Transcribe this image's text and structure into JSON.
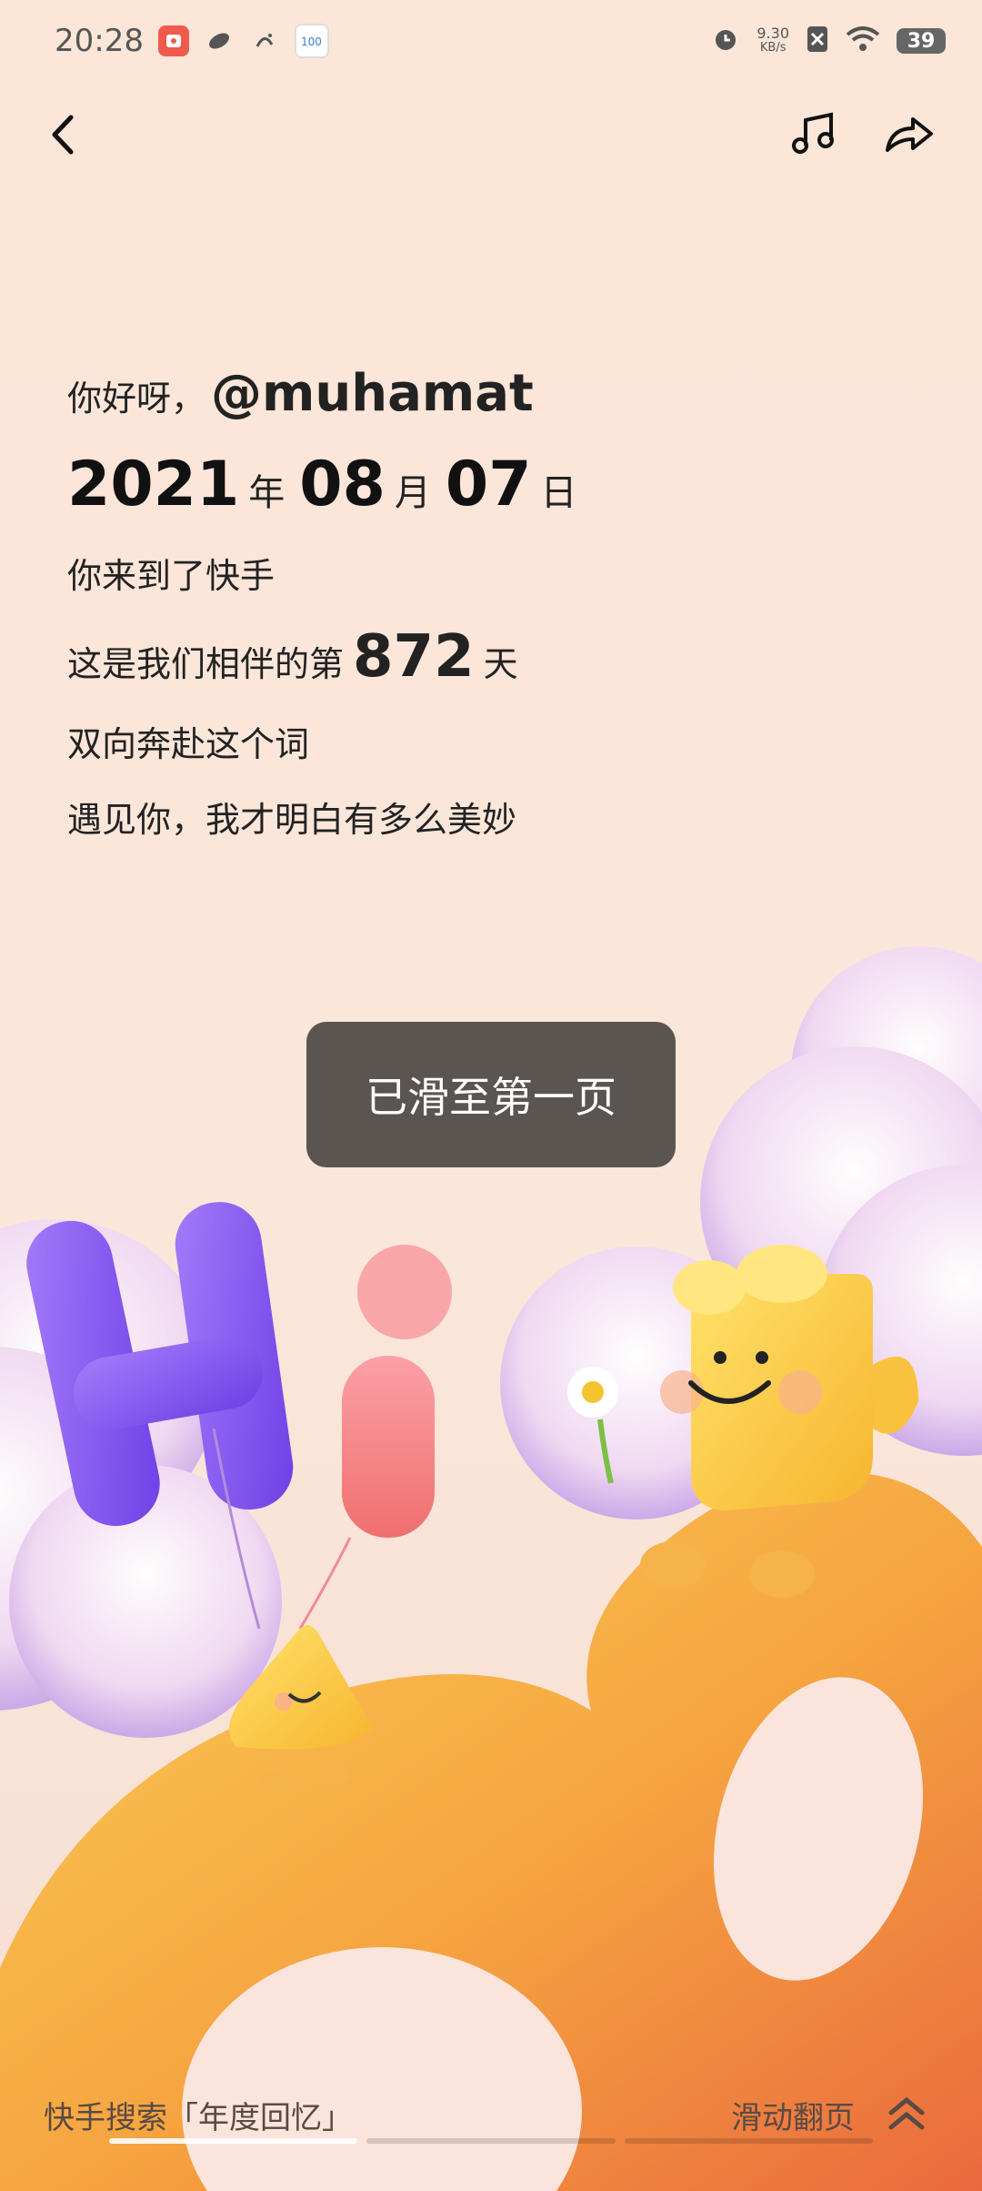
{
  "status_bar": {
    "time": "20:28",
    "net_speed_value": "9.30",
    "net_speed_unit": "KB/s",
    "battery": "39"
  },
  "nav": {
    "back_icon": "chevron-left-icon",
    "music_icon": "music-icon",
    "share_icon": "share-icon"
  },
  "greeting": {
    "hello": "你好呀，",
    "username": "@muhamat",
    "year": "2021",
    "year_unit": "年",
    "month": "08",
    "month_unit": "月",
    "day": "07",
    "day_unit": "日",
    "came_to": "你来到了快手",
    "companion_prefix": "这是我们相伴的第",
    "days": "872",
    "days_unit": "天",
    "line_mutual": "双向奔赴这个词",
    "line_meet": "遇见你，我才明白有多么美妙"
  },
  "toast": {
    "text": "已滑至第一页"
  },
  "bottom": {
    "search_hint": "快手搜索「年度回忆」",
    "swipe_hint": "滑动翻页"
  },
  "colors": {
    "background": "#fbe6d8",
    "toast_bg": "#5b5552",
    "accent_orange": "#f6a540",
    "accent_purple": "#8d5bf1",
    "accent_pink": "#f37d8a"
  }
}
